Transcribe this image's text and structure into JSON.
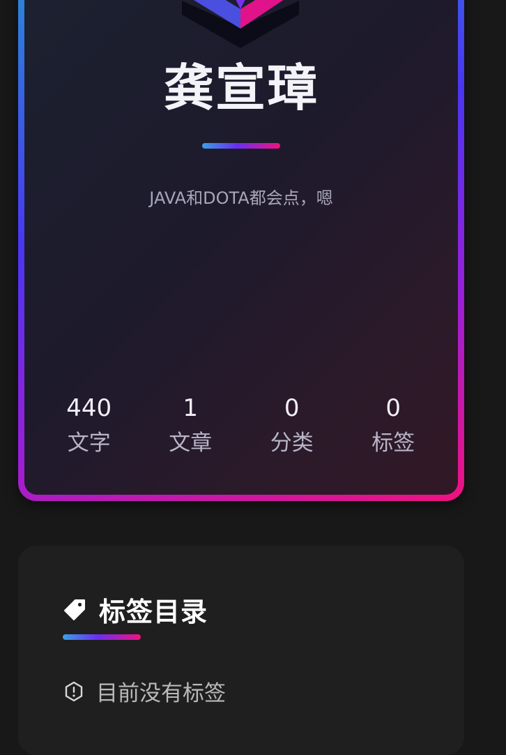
{
  "profile": {
    "name": "龚宣璋",
    "motto": "JAVA和DOTA都会点，嗯",
    "stats": [
      {
        "value": "440",
        "label": "文字"
      },
      {
        "value": "1",
        "label": "文章"
      },
      {
        "value": "0",
        "label": "分类"
      },
      {
        "value": "0",
        "label": "标签"
      }
    ]
  },
  "tags": {
    "title": "标签目录",
    "icon": "tag-icon",
    "empty_icon": "alert-octagon-icon",
    "empty_text": "目前没有标签"
  },
  "colors": {
    "accent_start": "#3aa0e6",
    "accent_mid": "#6a2ef0",
    "accent_end": "#f0127f",
    "background": "#181818",
    "card": "#1f1f1f"
  }
}
